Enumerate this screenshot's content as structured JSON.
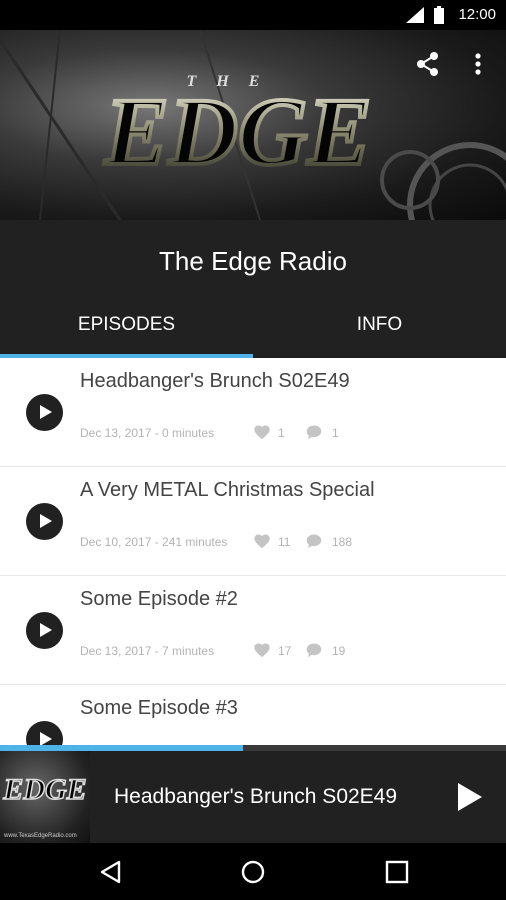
{
  "status_bar": {
    "time": "12:00"
  },
  "header": {
    "logo_text": "EDGE",
    "logo_small_top": "THE",
    "share_icon": "share-icon",
    "more_icon": "more-vert-icon"
  },
  "title": "The Edge Radio",
  "tabs": [
    {
      "label": "EPISODES",
      "selected": true
    },
    {
      "label": "INFO",
      "selected": false
    }
  ],
  "episodes": [
    {
      "title": "Headbanger's Brunch S02E49",
      "meta": "Dec 13, 2017 - 0 minutes",
      "likes": "1",
      "comments": "1"
    },
    {
      "title": "A Very METAL Christmas Special",
      "meta": "Dec 10, 2017 - 241 minutes",
      "likes": "11",
      "comments": "188"
    },
    {
      "title": "Some Episode #2",
      "meta": "Dec 13, 2017 - 7 minutes",
      "likes": "17",
      "comments": "19"
    },
    {
      "title": "Some Episode #3",
      "meta": "",
      "likes": "",
      "comments": ""
    }
  ],
  "player": {
    "progress": 0.48,
    "now_playing": "Headbanger's Brunch S02E49",
    "thumb_logo": "EDGE",
    "thumb_caption": "www.TexasEdgeRadio.com"
  },
  "colors": {
    "accent": "#4fb3ea",
    "dark": "#212121"
  }
}
